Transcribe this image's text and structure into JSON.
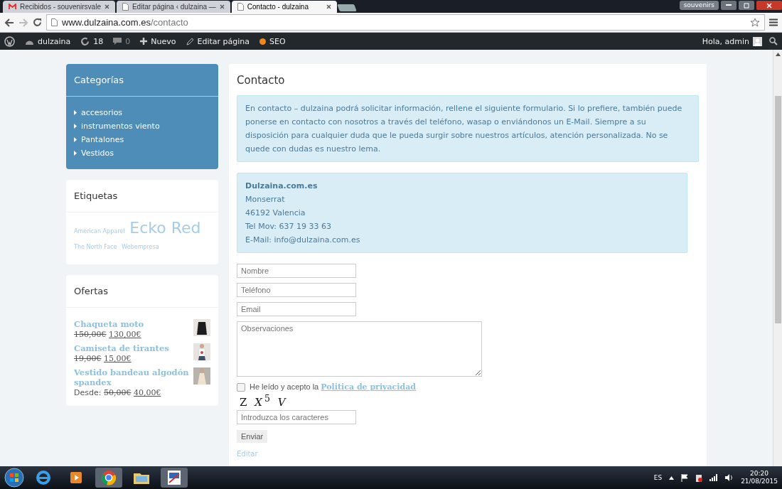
{
  "browser": {
    "tabs": [
      {
        "title": "Recibidos - souvenirsvale",
        "kind": "mail",
        "selected": false
      },
      {
        "title": "Editar página ‹ dulzaina —",
        "kind": "page",
        "selected": false
      },
      {
        "title": "Contacto - dulzaina",
        "kind": "page",
        "selected": true
      }
    ],
    "profile": "souvenirs",
    "url_host": "www.dulzaina.com.es",
    "url_path": "/contacto"
  },
  "admin_bar": {
    "site": "dulzaina",
    "updates": "18",
    "comments": "0",
    "new": "Nuevo",
    "edit": "Editar página",
    "seo": "SEO",
    "greeting": "Hola, admin"
  },
  "sidebar": {
    "categories": {
      "title": "Categorías",
      "items": [
        "accesorios",
        "instrumentos viento",
        "Pantalones",
        "Vestidos"
      ]
    },
    "tags": {
      "title": "Etiquetas",
      "items": [
        {
          "label": "American Apparel",
          "kind": "small"
        },
        {
          "label": "Ecko Red",
          "kind": "large"
        },
        {
          "label": "The North Face",
          "kind": "small"
        },
        {
          "label": "Webempresa",
          "kind": "small"
        }
      ]
    },
    "offers": {
      "title": "Ofertas",
      "items": [
        {
          "name": "Chaqueta moto",
          "old_price": "150,00€",
          "price": "130,00€",
          "kind": "jacket"
        },
        {
          "name": "Camiseta de tirantes",
          "old_price": "19,00€",
          "price": "15,00€",
          "kind": "top"
        },
        {
          "name": "Vestido bandeau algodón spandex",
          "prefix": "Desde:",
          "old_price": "50,00€",
          "price": "40,00€",
          "kind": "dress"
        }
      ]
    }
  },
  "main": {
    "title": "Contacto",
    "intro": "En contacto – dulzaina podrá solicitar información, rellene el siguiente formulario. Si lo prefiere, también puede ponerse en contacto con nosotros a través del teléfono, wasap o enviándonos un E-Mail. Siempre a su disposición para cualquier duda que le pueda surgir sobre nuestros artículos, atención personalizada. No se quede con dudas es nuestro lema.",
    "address": {
      "name": "Dulzaina.com.es",
      "lines": [
        "Monserrat",
        "46192 Valencia",
        "Tel Mov: 637 19 33 63",
        "E-Mail: info@dulzaina.com.es"
      ]
    },
    "fields": [
      {
        "placeholder": "Nombre",
        "kind": "input"
      },
      {
        "placeholder": "Teléfono",
        "kind": "input"
      },
      {
        "placeholder": "Email",
        "kind": "input"
      },
      {
        "placeholder": "Observaciones",
        "kind": "textarea"
      }
    ],
    "consent": {
      "text": "He leído y acepto la",
      "link": "Politica de privacidad",
      "checked": false
    },
    "captcha": "Z *X*$^{5}$ *V*",
    "captcha_field": {
      "placeholder": "Introduzca los caracteres"
    },
    "submit": "Enviar",
    "edit_link": "Editar"
  },
  "taskbar": {
    "language": "ES",
    "time": "20:20",
    "date": "21/08/2015"
  }
}
